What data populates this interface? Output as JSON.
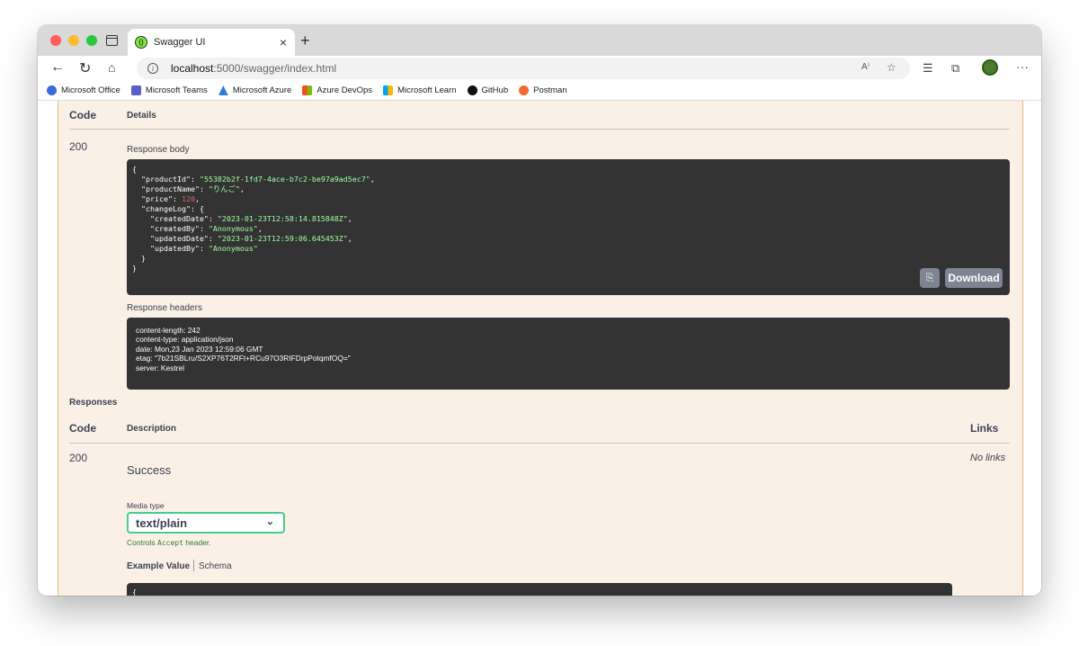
{
  "browser": {
    "tab_title": "Swagger UI",
    "tab_close": "×",
    "new_tab": "+",
    "url_host": "localhost",
    "url_path": ":5000/swagger/index.html",
    "bookmarks": [
      {
        "label": "Microsoft Office",
        "icon": "microsoft-office-icon",
        "color": "#3b6ad6"
      },
      {
        "label": "Microsoft Teams",
        "icon": "microsoft-teams-icon",
        "color": "#5b5fc7"
      },
      {
        "label": "Microsoft Azure",
        "icon": "azure-icon",
        "color": "#2f7fd8"
      },
      {
        "label": "Azure DevOps",
        "icon": "microsoft-logo-icon",
        "color": "#f3a21b"
      },
      {
        "label": "Microsoft Learn",
        "icon": "microsoft-logo-icon",
        "color": "#f3a21b"
      },
      {
        "label": "GitHub",
        "icon": "github-icon",
        "color": "#111111"
      },
      {
        "label": "Postman",
        "icon": "postman-icon",
        "color": "#ef6c2e"
      }
    ]
  },
  "server_response": {
    "col_code": "Code",
    "col_details": "Details",
    "code": "200",
    "response_body_label": "Response body",
    "response_body": {
      "open": "{",
      "productId_key": "\"productId\"",
      "productId_val": "\"55382b2f-1fd7-4ace-b7c2-be97a9ad5ec7\"",
      "productName_key": "\"productName\"",
      "productName_val": "\"りんご\"",
      "price_key": "\"price\"",
      "price_val": "120",
      "changeLog_key": "\"changeLog\"",
      "createdDate_key": "\"createdDate\"",
      "createdDate_val": "\"2023-01-23T12:58:14.815848Z\"",
      "createdBy_key": "\"createdBy\"",
      "createdBy_val": "\"Anonymous\"",
      "updatedDate_key": "\"updatedDate\"",
      "updatedDate_val": "\"2023-01-23T12:59:06.645453Z\"",
      "updatedBy_key": "\"updatedBy\"",
      "updatedBy_val": "\"Anonymous\"",
      "inner_close": "}",
      "close": "}"
    },
    "download_label": "Download",
    "response_headers_label": "Response headers",
    "headers": [
      "content-length: 242",
      "content-type: application/json",
      "date: Mon,23 Jan 2023 12:59:06 GMT",
      "etag: \"7b21SBLru/S2XP76T2RFt+RCu97O3RIFDrpPotqmfOQ=\"",
      "server: Kestrel"
    ]
  },
  "responses": {
    "title": "Responses",
    "col_code": "Code",
    "col_description": "Description",
    "col_links": "Links",
    "code": "200",
    "description": "Success",
    "links": "No links",
    "media_type_label": "Media type",
    "media_type_value": "text/plain",
    "controls_prefix": "Controls ",
    "controls_code": "Accept",
    "controls_suffix": " header.",
    "example_value_tab": "Example Value",
    "schema_tab": "Schema",
    "example_open": "{"
  }
}
